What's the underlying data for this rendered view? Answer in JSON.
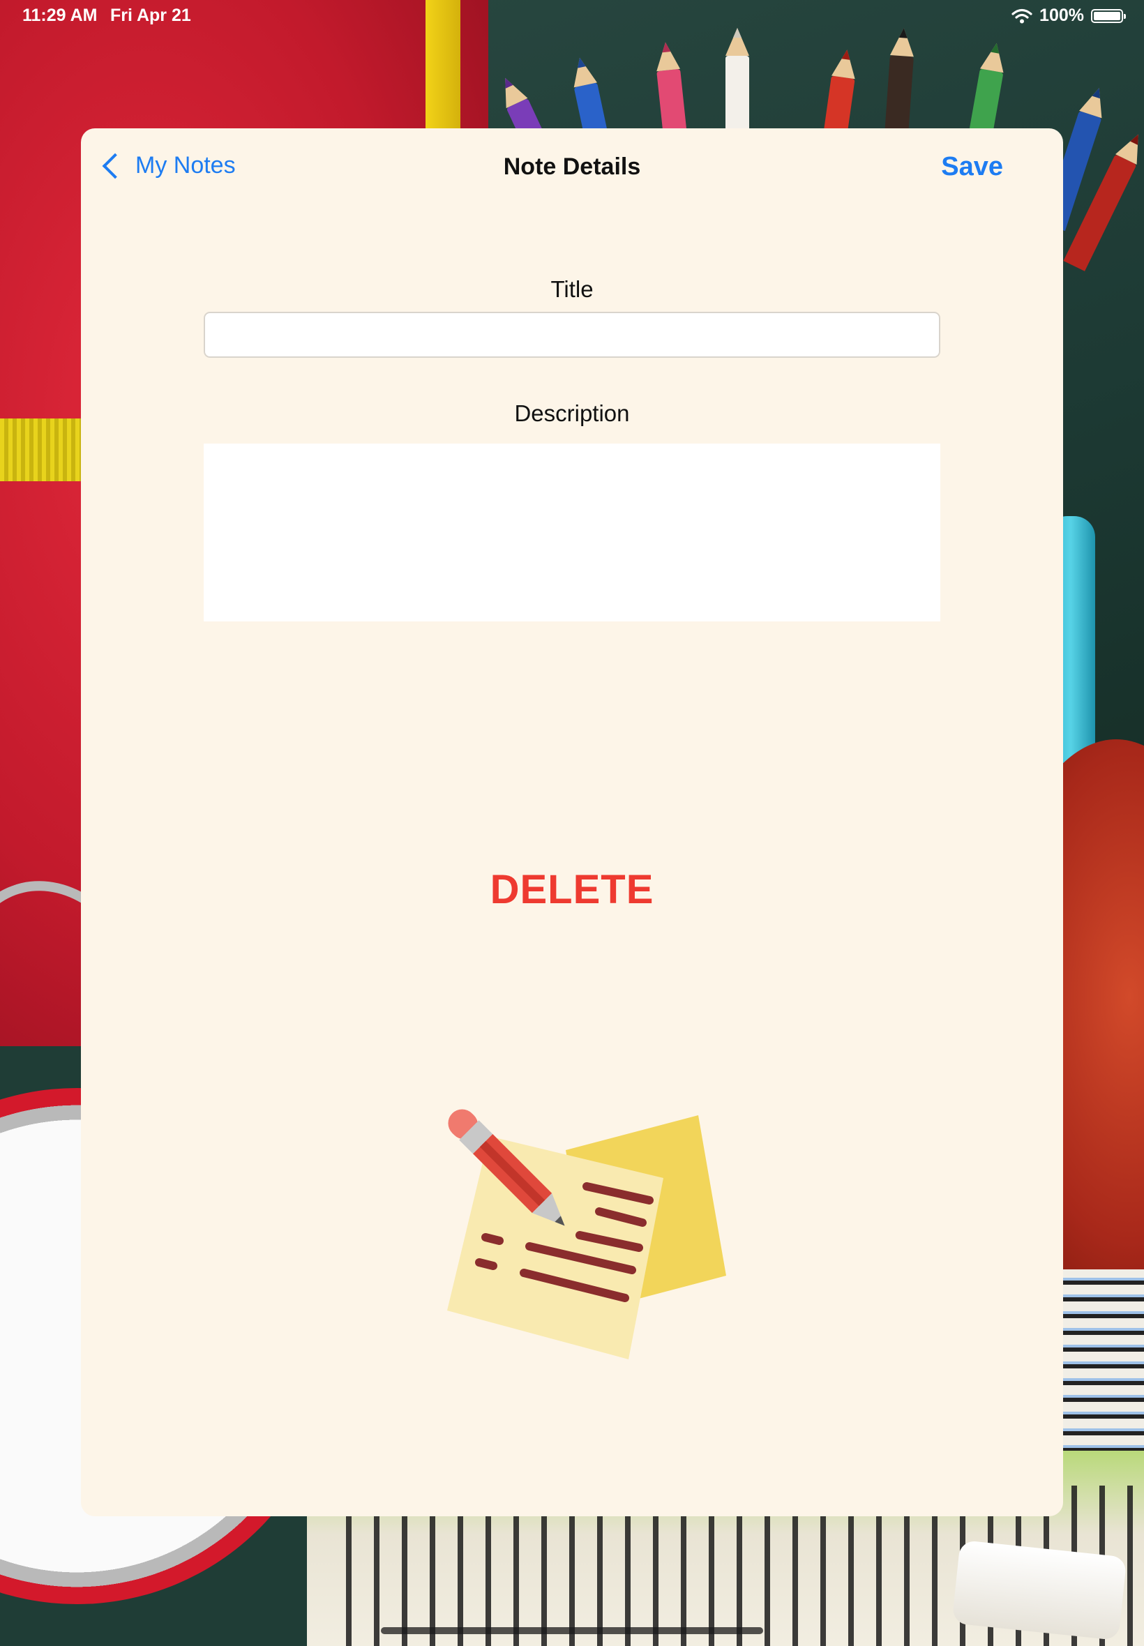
{
  "status_bar": {
    "time": "11:29 AM",
    "date": "Fri Apr 21",
    "battery": "100%"
  },
  "nav": {
    "back_label": "My Notes",
    "title": "Note Details",
    "save_label": "Save"
  },
  "form": {
    "title_label": "Title",
    "title_value": "",
    "description_label": "Description",
    "description_value": ""
  },
  "actions": {
    "delete_label": "DELETE"
  },
  "colors": {
    "accent_blue": "#1d7cf2",
    "delete_red": "#ee3a30",
    "sheet_background": "#fdf5e8"
  },
  "icons": {
    "back": "chevron-left-icon",
    "wifi": "wifi-icon",
    "battery": "battery-icon",
    "illustration": "sticky-notes-pencil-illustration"
  }
}
